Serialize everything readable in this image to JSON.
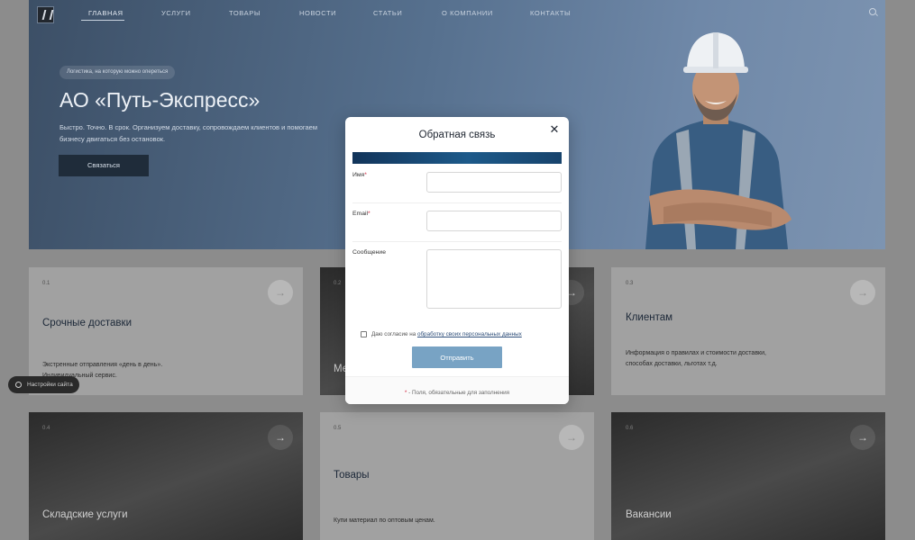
{
  "nav": {
    "items": [
      {
        "label": "ГЛАВНАЯ",
        "active": true
      },
      {
        "label": "УСЛУГИ"
      },
      {
        "label": "ТОВАРЫ"
      },
      {
        "label": "НОВОСТИ"
      },
      {
        "label": "СТАТЬИ"
      },
      {
        "label": "О КОМПАНИИ"
      },
      {
        "label": "КОНТАКТЫ"
      }
    ],
    "search_icon": "search-icon"
  },
  "hero": {
    "tagline": "Логистика, на которую можно опереться",
    "title": "АО «Путь-Экспресс»",
    "text": "Быстро. Точно. В срок. Организуем доставку, сопровождаем клиентов и помогаем бизнесу двигаться без остановок.",
    "button": "Связаться"
  },
  "cards": [
    {
      "num": "0.1",
      "title": "Срочные доставки",
      "text": "Экстренные отправления «день в день». Индивидуальный сервис."
    },
    {
      "num": "0.2",
      "title": "Ме"
    },
    {
      "num": "0.3",
      "title": "Клиентам",
      "text": "Информация о правилах и стоимости доставки, способах доставки, льготах т.д."
    },
    {
      "num": "0.4",
      "title": "Складские услуги"
    },
    {
      "num": "0.5",
      "title": "Товары",
      "text": "Купи материал по оптовым ценам."
    },
    {
      "num": "0.6",
      "title": "Вакансии"
    }
  ],
  "settings": {
    "label": "Настройки сайта"
  },
  "modal": {
    "title": "Обратная связь",
    "close": "✕",
    "fields": {
      "name_label": "Имя",
      "email_label": "Email",
      "message_label": "Сообщение",
      "required_mark": "*"
    },
    "consent_text": "Даю согласие на",
    "consent_link": "обработку своих персональных данных",
    "submit": "Отправить",
    "footnote": "- Поля, обязательные для заполнения"
  },
  "colors": {
    "accent_bar": "#1d5a8a",
    "submit_button": "#78a3c4",
    "required": "#d0213a",
    "hero_button": "#1f2c3a"
  }
}
